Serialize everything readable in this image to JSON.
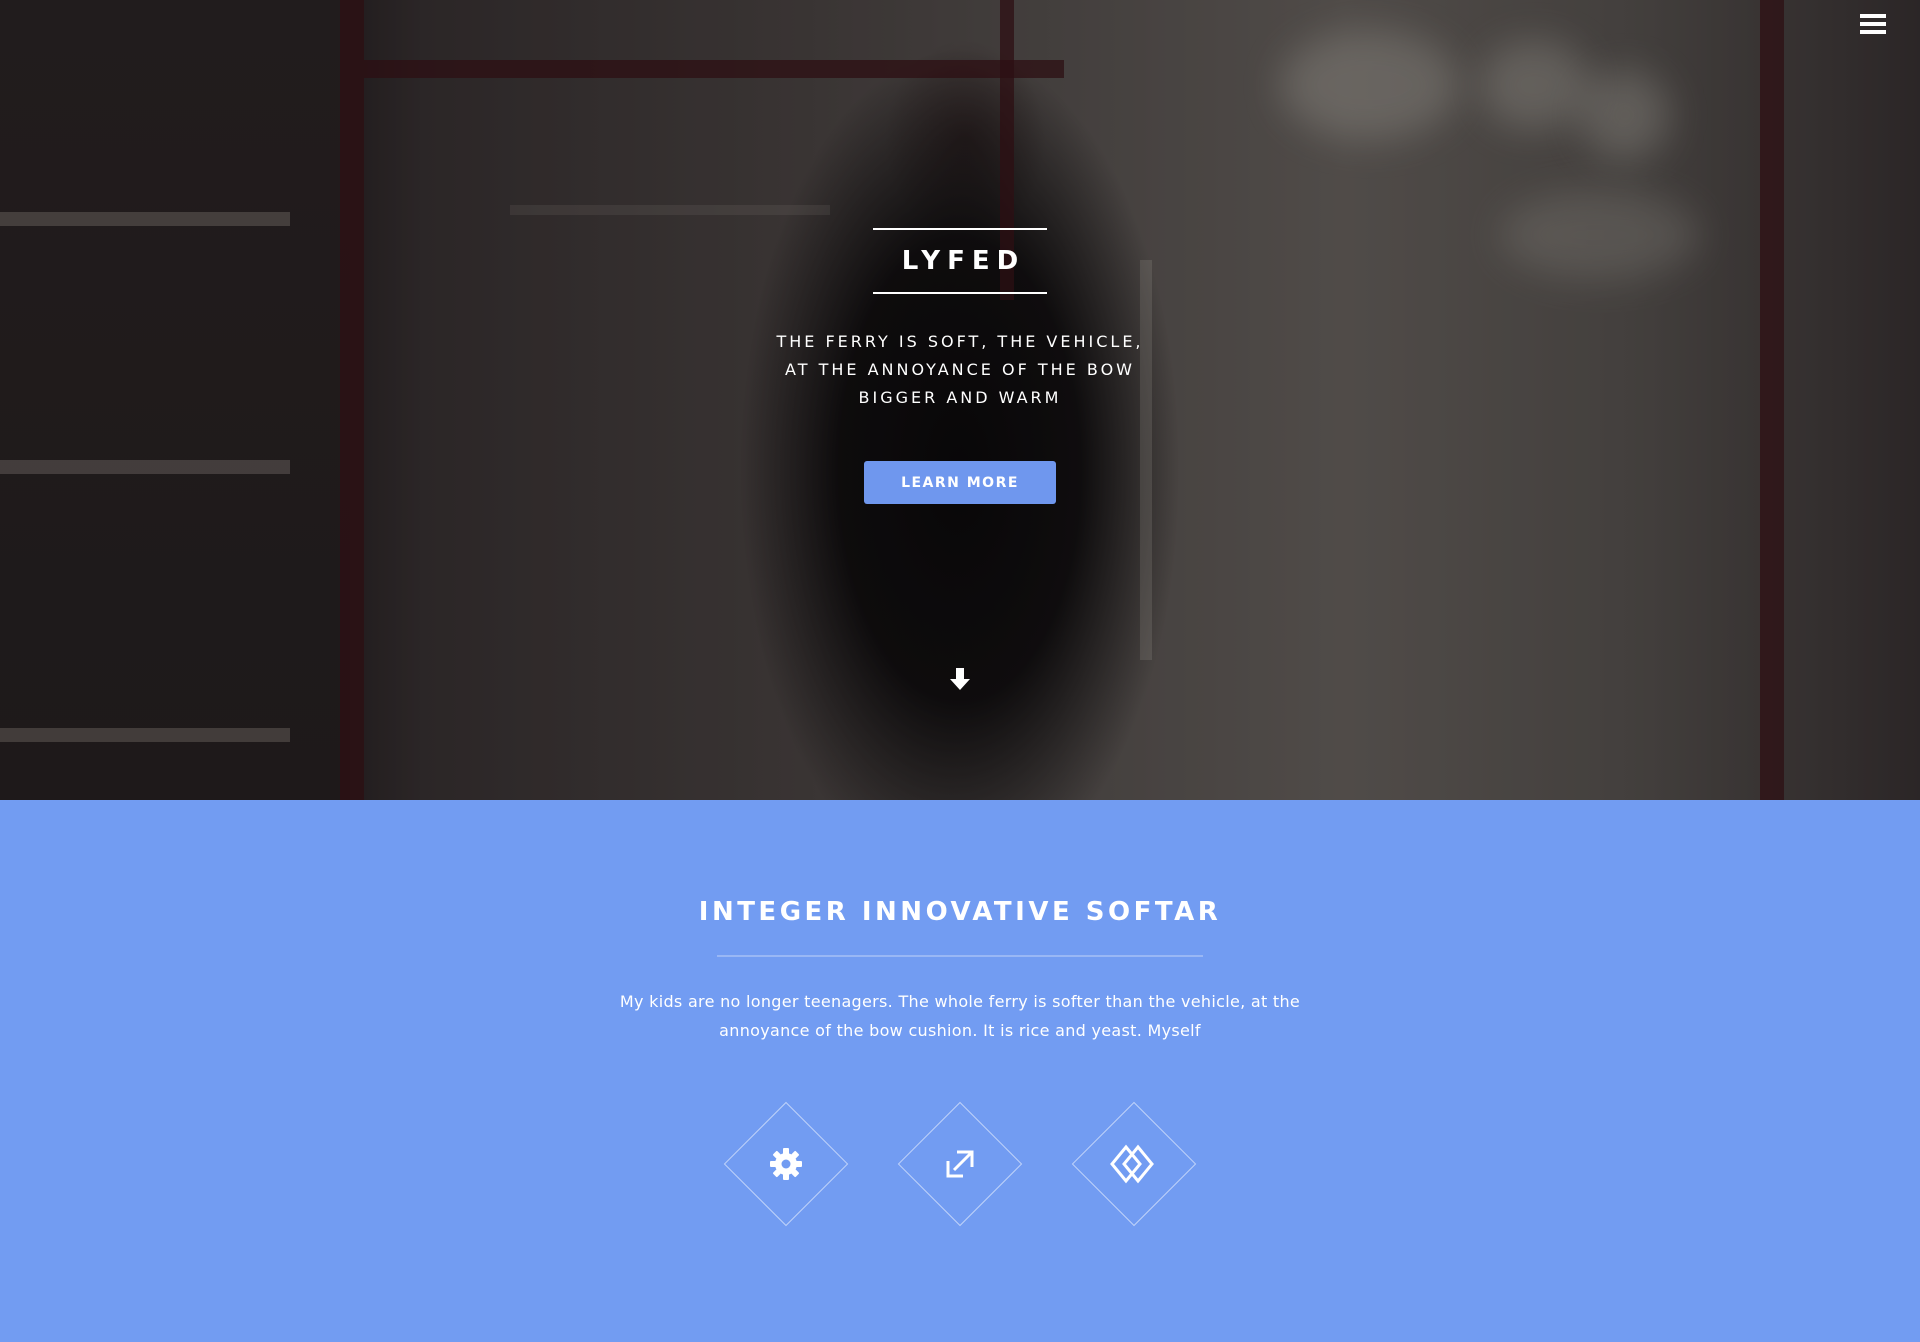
{
  "hero": {
    "brand": "LYFED",
    "tagline_lines": [
      "THE FERRY IS SOFT, THE VEHICLE,",
      "AT THE ANNOYANCE OF THE BOW",
      "BIGGER AND WARM"
    ],
    "button_label": "LEARN MORE",
    "menu_icon": "hamburger-menu-icon",
    "scroll_icon": "arrow-down-icon"
  },
  "features": {
    "title": "INTEGER INNOVATIVE SOFTAR",
    "text_lines": [
      "My kids are no longer teenagers. The whole ferry is softer than the vehicle, at the",
      "annoyance of the bow cushion. It is rice and yeast. Myself"
    ],
    "icons": [
      "gear-icon",
      "expand-arrows-icon",
      "overlapping-diamonds-icon"
    ]
  },
  "colors": {
    "accent": "#729cf2",
    "button": "#6f97ee",
    "text": "#ffffff"
  }
}
